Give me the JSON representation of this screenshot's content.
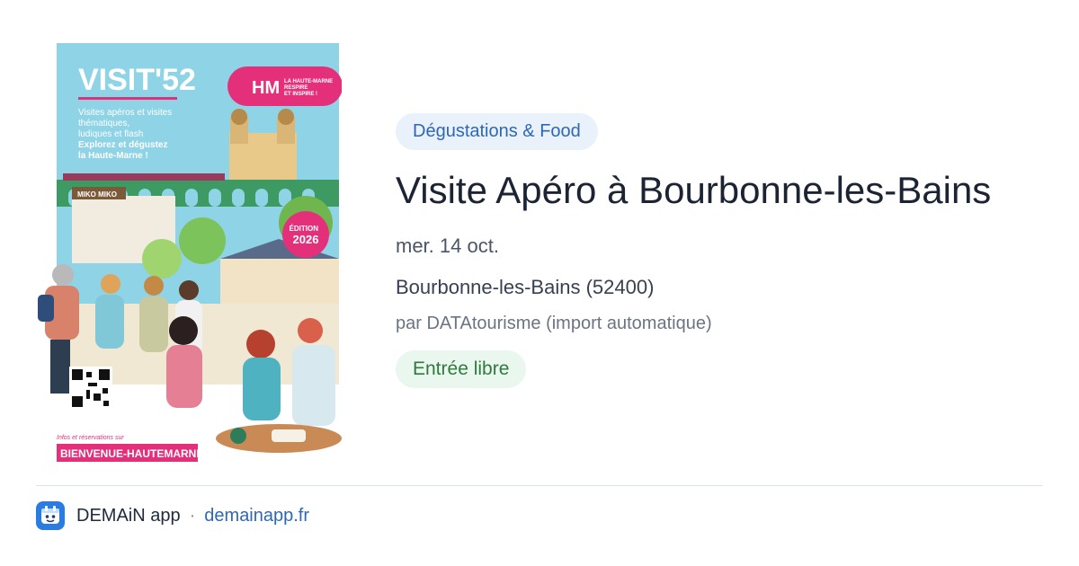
{
  "poster": {
    "brand_title": "VISIT'52",
    "subtitle_lines": [
      "Visites apéros et visites",
      "thématiques,",
      "ludiques et flash"
    ],
    "tagline_lines": [
      "Explorez et dégustez",
      "la Haute-Marne !"
    ],
    "logo_text_lines": [
      "LA HAUTE-MARNE",
      "RESPIRE",
      "ET INSPIRE !"
    ],
    "edition_lines": [
      "ÉDITION",
      "2026"
    ],
    "info_label": "Infos et réservations sur",
    "website_banner": "BIENVENUE-HAUTEMARNE.FR",
    "sign_text": "MIKO MIKO"
  },
  "event": {
    "category": "Dégustations & Food",
    "title": "Visite Apéro à Bourbonne-les-Bains",
    "date": "mer. 14 oct.",
    "location": "Bourbonne-les-Bains (52400)",
    "organizer": "par DATAtourisme (import automatique)",
    "price": "Entrée libre"
  },
  "footer": {
    "app_name": "DEMAiN app",
    "separator": "·",
    "site": "demainapp.fr"
  },
  "colors": {
    "category_bg": "#e9f1fb",
    "category_text": "#2f67b5",
    "price_bg": "#eaf7ee",
    "price_text": "#2f7a3e",
    "poster_sky": "#8fd3e6",
    "poster_accent": "#e4307a",
    "app_icon": "#2a7ce0"
  }
}
